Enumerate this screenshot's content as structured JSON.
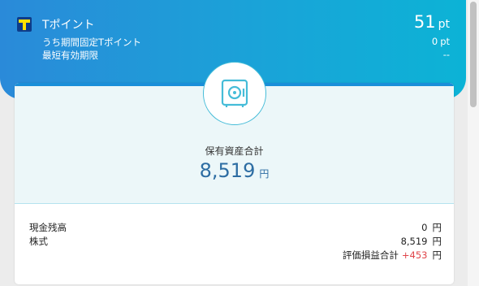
{
  "header": {
    "title": "Tポイント",
    "points_value": "51",
    "points_unit": "pt",
    "limited_label": "うち期間固定Tポイント",
    "limited_value": "0",
    "limited_unit": "pt",
    "expiry_label": "最短有効期限",
    "expiry_value": "--",
    "gradient_start": "#2a8ad9",
    "gradient_end": "#0cb3d6",
    "logo_icon": "t-point-logo-icon"
  },
  "summary": {
    "icon": "safe-icon",
    "total_label": "保有資産合計",
    "total_value": "8,519",
    "total_unit": "円",
    "accent": "#2d6da3"
  },
  "breakdown": {
    "cash_label": "現金残高",
    "cash_value": "0",
    "cash_unit": "円",
    "stock_label": "株式",
    "stock_value": "8,519",
    "stock_unit": "円",
    "pl_label": "評価損益合計",
    "pl_value": "+453",
    "pl_unit": "円",
    "gain_color": "#e0454a"
  }
}
